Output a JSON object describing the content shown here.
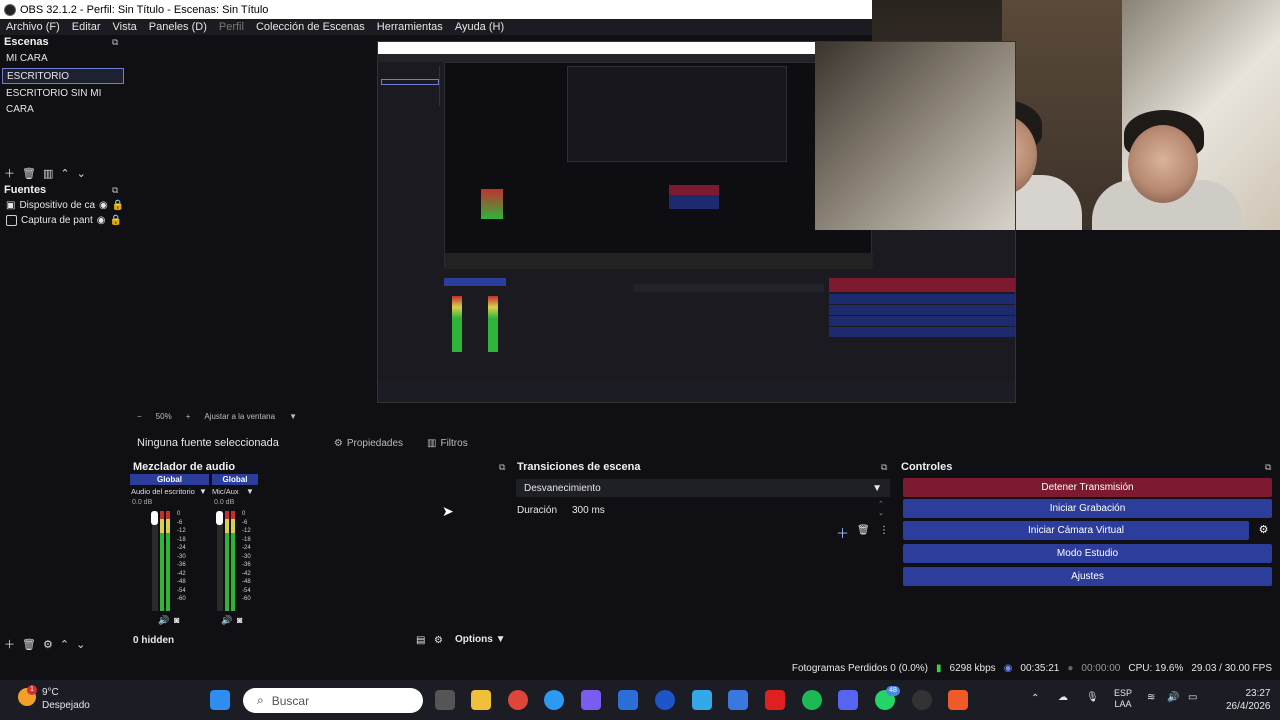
{
  "window": {
    "title": "OBS 32.1.2 - Perfil: Sin Título - Escenas: Sin Título"
  },
  "menu": [
    "Archivo (F)",
    "Editar",
    "Vista",
    "Paneles (D)",
    "Perfil",
    "Colección de Escenas",
    "Herramientas",
    "Ayuda (H)"
  ],
  "scenes": {
    "title": "Escenas",
    "items": [
      "MI CARA",
      "ESCRITORIO",
      "ESCRITORIO SIN MI CARA"
    ],
    "selected": "ESCRITORIO"
  },
  "sources": {
    "title": "Fuentes",
    "items": [
      "Dispositivo de ca",
      "Captura de pant"
    ]
  },
  "preview": {
    "zoom": "50%",
    "fit_label": "Ajustar a la ventana"
  },
  "context": {
    "no_source": "Ninguna fuente seleccionada",
    "properties": "Propiedades",
    "filters": "Filtros"
  },
  "mixer": {
    "title": "Mezclador de audio",
    "channels": [
      {
        "header": "Global",
        "name": "Audio del escritorio",
        "level": "0.0 dB"
      },
      {
        "header": "Global",
        "name": "Mic/Aux",
        "level": "0.0 dB"
      }
    ],
    "scale": [
      "0",
      "-6",
      "-12",
      "-18",
      "-24",
      "-30",
      "-36",
      "-42",
      "-48",
      "-54",
      "-60"
    ],
    "hidden": "0 hidden",
    "options": "Options"
  },
  "transitions": {
    "title": "Transiciones de escena",
    "selected": "Desvanecimiento",
    "duration_label": "Duración",
    "duration_value": "300 ms"
  },
  "controls": {
    "title": "Controles",
    "buttons": [
      "Detener Transmisión",
      "Iniciar Grabación",
      "Iniciar Cámara Virtual",
      "Modo Estudio",
      "Ajustes"
    ]
  },
  "status": {
    "dropped": "Fotogramas Perdidos 0 (0.0%)",
    "bitrate": "6298 kbps",
    "stream_time": "00:35:21",
    "rec_time": "00:00:00",
    "cpu": "CPU: 19.6%",
    "fps": "29.03 / 30.00 FPS"
  },
  "taskbar": {
    "weather_temp": "9°C",
    "weather_desc": "Despejado",
    "weather_badge": "1",
    "search_placeholder": "Buscar",
    "lang_top": "ESP",
    "lang_bottom": "LAA",
    "time": "23:27",
    "date": "26/4/2026",
    "badge": "48"
  },
  "colors": {
    "stop": "#7d1a2f",
    "accent": "#2d3d9b",
    "panel": "#101014"
  }
}
